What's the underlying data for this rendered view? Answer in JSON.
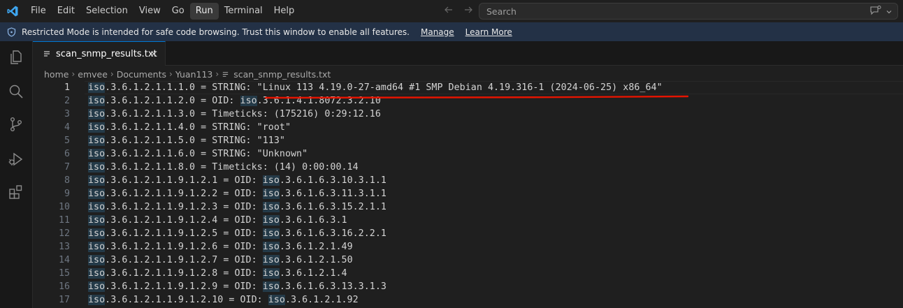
{
  "menu": [
    "File",
    "Edit",
    "Selection",
    "View",
    "Go",
    "Run",
    "Terminal",
    "Help"
  ],
  "active_menu_index": 5,
  "search": {
    "placeholder": "Search"
  },
  "banner": {
    "message": "Restricted Mode is intended for safe code browsing. Trust this window to enable all features.",
    "manage": "Manage",
    "learn_more": "Learn More"
  },
  "tab": {
    "label": "scan_snmp_results.txt"
  },
  "breadcrumbs": [
    "home",
    "emvee",
    "Documents",
    "Yuan113",
    "scan_snmp_results.txt"
  ],
  "editor": {
    "lines": [
      {
        "num": "1",
        "prefix": "iso",
        "rest": ".3.6.1.2.1.1.1.0 = STRING: \"Linux 113 4.19.0-27-amd64 #1 SMP Debian 4.19.316-1 (2024-06-25) x86_64\"",
        "oid_prefix": "",
        "oid_rest": ""
      },
      {
        "num": "2",
        "prefix": "iso",
        "rest": ".3.6.1.2.1.1.2.0 = OID: ",
        "oid_prefix": "iso",
        "oid_rest": ".3.6.1.4.1.8072.3.2.10"
      },
      {
        "num": "3",
        "prefix": "iso",
        "rest": ".3.6.1.2.1.1.3.0 = Timeticks: (175216) 0:29:12.16",
        "oid_prefix": "",
        "oid_rest": ""
      },
      {
        "num": "4",
        "prefix": "iso",
        "rest": ".3.6.1.2.1.1.4.0 = STRING: \"root\"",
        "oid_prefix": "",
        "oid_rest": ""
      },
      {
        "num": "5",
        "prefix": "iso",
        "rest": ".3.6.1.2.1.1.5.0 = STRING: \"113\"",
        "oid_prefix": "",
        "oid_rest": ""
      },
      {
        "num": "6",
        "prefix": "iso",
        "rest": ".3.6.1.2.1.1.6.0 = STRING: \"Unknown\"",
        "oid_prefix": "",
        "oid_rest": ""
      },
      {
        "num": "7",
        "prefix": "iso",
        "rest": ".3.6.1.2.1.1.8.0 = Timeticks: (14) 0:00:00.14",
        "oid_prefix": "",
        "oid_rest": ""
      },
      {
        "num": "8",
        "prefix": "iso",
        "rest": ".3.6.1.2.1.1.9.1.2.1 = OID: ",
        "oid_prefix": "iso",
        "oid_rest": ".3.6.1.6.3.10.3.1.1"
      },
      {
        "num": "9",
        "prefix": "iso",
        "rest": ".3.6.1.2.1.1.9.1.2.2 = OID: ",
        "oid_prefix": "iso",
        "oid_rest": ".3.6.1.6.3.11.3.1.1"
      },
      {
        "num": "10",
        "prefix": "iso",
        "rest": ".3.6.1.2.1.1.9.1.2.3 = OID: ",
        "oid_prefix": "iso",
        "oid_rest": ".3.6.1.6.3.15.2.1.1"
      },
      {
        "num": "11",
        "prefix": "iso",
        "rest": ".3.6.1.2.1.1.9.1.2.4 = OID: ",
        "oid_prefix": "iso",
        "oid_rest": ".3.6.1.6.3.1"
      },
      {
        "num": "12",
        "prefix": "iso",
        "rest": ".3.6.1.2.1.1.9.1.2.5 = OID: ",
        "oid_prefix": "iso",
        "oid_rest": ".3.6.1.6.3.16.2.2.1"
      },
      {
        "num": "13",
        "prefix": "iso",
        "rest": ".3.6.1.2.1.1.9.1.2.6 = OID: ",
        "oid_prefix": "iso",
        "oid_rest": ".3.6.1.2.1.49"
      },
      {
        "num": "14",
        "prefix": "iso",
        "rest": ".3.6.1.2.1.1.9.1.2.7 = OID: ",
        "oid_prefix": "iso",
        "oid_rest": ".3.6.1.2.1.50"
      },
      {
        "num": "15",
        "prefix": "iso",
        "rest": ".3.6.1.2.1.1.9.1.2.8 = OID: ",
        "oid_prefix": "iso",
        "oid_rest": ".3.6.1.2.1.4"
      },
      {
        "num": "16",
        "prefix": "iso",
        "rest": ".3.6.1.2.1.1.9.1.2.9 = OID: ",
        "oid_prefix": "iso",
        "oid_rest": ".3.6.1.6.3.13.3.1.3"
      },
      {
        "num": "17",
        "prefix": "iso",
        "rest": ".3.6.1.2.1.1.9.1.2.10 = OID: ",
        "oid_prefix": "iso",
        "oid_rest": ".3.6.1.2.1.92"
      }
    ],
    "current_line": 1
  },
  "colors": {
    "accent": "#0078d4",
    "annotation": "#e51400",
    "banner": "#233146",
    "word_highlight": "#243a48"
  }
}
